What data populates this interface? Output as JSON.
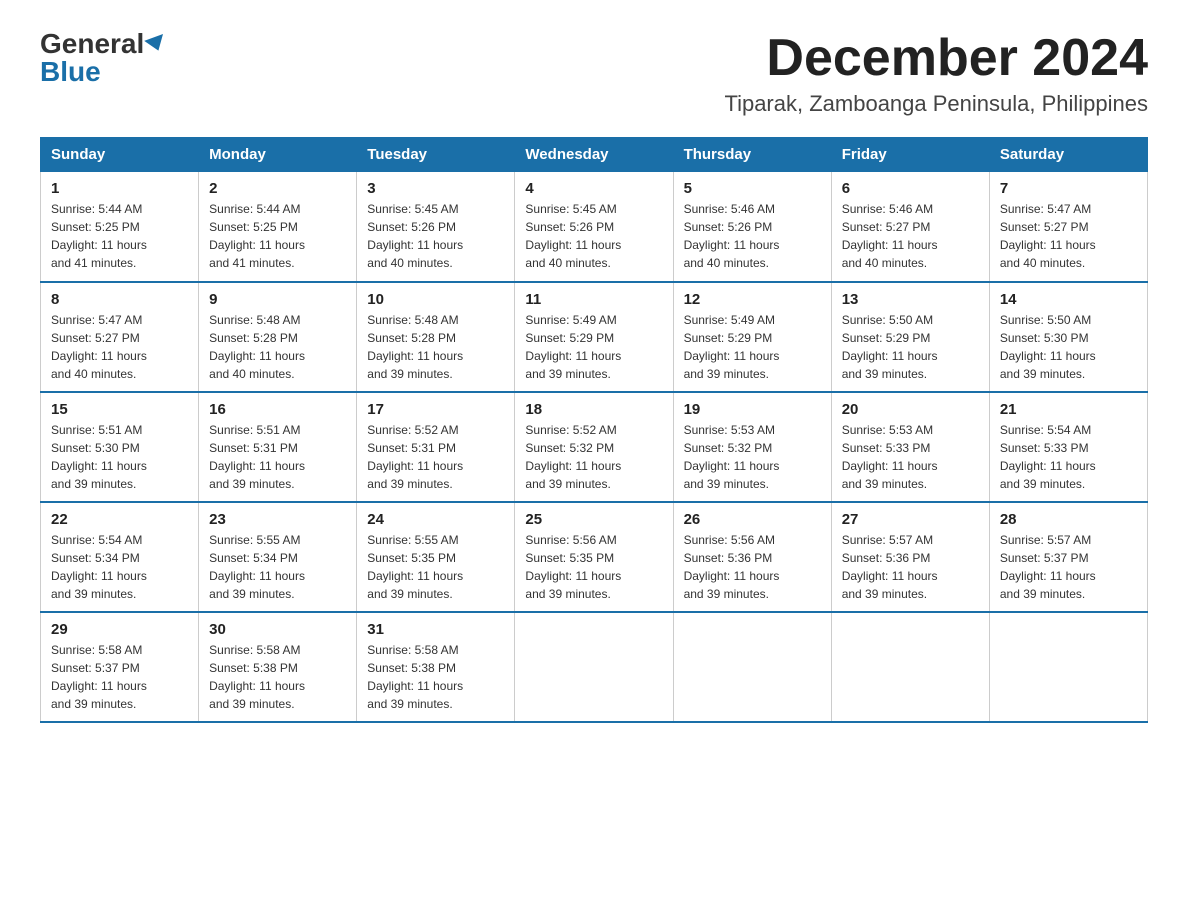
{
  "logo": {
    "general": "General",
    "blue": "Blue"
  },
  "title": "December 2024",
  "subtitle": "Tiparak, Zamboanga Peninsula, Philippines",
  "days_header": [
    "Sunday",
    "Monday",
    "Tuesday",
    "Wednesday",
    "Thursday",
    "Friday",
    "Saturday"
  ],
  "weeks": [
    [
      {
        "day": "1",
        "info": "Sunrise: 5:44 AM\nSunset: 5:25 PM\nDaylight: 11 hours\nand 41 minutes."
      },
      {
        "day": "2",
        "info": "Sunrise: 5:44 AM\nSunset: 5:25 PM\nDaylight: 11 hours\nand 41 minutes."
      },
      {
        "day": "3",
        "info": "Sunrise: 5:45 AM\nSunset: 5:26 PM\nDaylight: 11 hours\nand 40 minutes."
      },
      {
        "day": "4",
        "info": "Sunrise: 5:45 AM\nSunset: 5:26 PM\nDaylight: 11 hours\nand 40 minutes."
      },
      {
        "day": "5",
        "info": "Sunrise: 5:46 AM\nSunset: 5:26 PM\nDaylight: 11 hours\nand 40 minutes."
      },
      {
        "day": "6",
        "info": "Sunrise: 5:46 AM\nSunset: 5:27 PM\nDaylight: 11 hours\nand 40 minutes."
      },
      {
        "day": "7",
        "info": "Sunrise: 5:47 AM\nSunset: 5:27 PM\nDaylight: 11 hours\nand 40 minutes."
      }
    ],
    [
      {
        "day": "8",
        "info": "Sunrise: 5:47 AM\nSunset: 5:27 PM\nDaylight: 11 hours\nand 40 minutes."
      },
      {
        "day": "9",
        "info": "Sunrise: 5:48 AM\nSunset: 5:28 PM\nDaylight: 11 hours\nand 40 minutes."
      },
      {
        "day": "10",
        "info": "Sunrise: 5:48 AM\nSunset: 5:28 PM\nDaylight: 11 hours\nand 39 minutes."
      },
      {
        "day": "11",
        "info": "Sunrise: 5:49 AM\nSunset: 5:29 PM\nDaylight: 11 hours\nand 39 minutes."
      },
      {
        "day": "12",
        "info": "Sunrise: 5:49 AM\nSunset: 5:29 PM\nDaylight: 11 hours\nand 39 minutes."
      },
      {
        "day": "13",
        "info": "Sunrise: 5:50 AM\nSunset: 5:29 PM\nDaylight: 11 hours\nand 39 minutes."
      },
      {
        "day": "14",
        "info": "Sunrise: 5:50 AM\nSunset: 5:30 PM\nDaylight: 11 hours\nand 39 minutes."
      }
    ],
    [
      {
        "day": "15",
        "info": "Sunrise: 5:51 AM\nSunset: 5:30 PM\nDaylight: 11 hours\nand 39 minutes."
      },
      {
        "day": "16",
        "info": "Sunrise: 5:51 AM\nSunset: 5:31 PM\nDaylight: 11 hours\nand 39 minutes."
      },
      {
        "day": "17",
        "info": "Sunrise: 5:52 AM\nSunset: 5:31 PM\nDaylight: 11 hours\nand 39 minutes."
      },
      {
        "day": "18",
        "info": "Sunrise: 5:52 AM\nSunset: 5:32 PM\nDaylight: 11 hours\nand 39 minutes."
      },
      {
        "day": "19",
        "info": "Sunrise: 5:53 AM\nSunset: 5:32 PM\nDaylight: 11 hours\nand 39 minutes."
      },
      {
        "day": "20",
        "info": "Sunrise: 5:53 AM\nSunset: 5:33 PM\nDaylight: 11 hours\nand 39 minutes."
      },
      {
        "day": "21",
        "info": "Sunrise: 5:54 AM\nSunset: 5:33 PM\nDaylight: 11 hours\nand 39 minutes."
      }
    ],
    [
      {
        "day": "22",
        "info": "Sunrise: 5:54 AM\nSunset: 5:34 PM\nDaylight: 11 hours\nand 39 minutes."
      },
      {
        "day": "23",
        "info": "Sunrise: 5:55 AM\nSunset: 5:34 PM\nDaylight: 11 hours\nand 39 minutes."
      },
      {
        "day": "24",
        "info": "Sunrise: 5:55 AM\nSunset: 5:35 PM\nDaylight: 11 hours\nand 39 minutes."
      },
      {
        "day": "25",
        "info": "Sunrise: 5:56 AM\nSunset: 5:35 PM\nDaylight: 11 hours\nand 39 minutes."
      },
      {
        "day": "26",
        "info": "Sunrise: 5:56 AM\nSunset: 5:36 PM\nDaylight: 11 hours\nand 39 minutes."
      },
      {
        "day": "27",
        "info": "Sunrise: 5:57 AM\nSunset: 5:36 PM\nDaylight: 11 hours\nand 39 minutes."
      },
      {
        "day": "28",
        "info": "Sunrise: 5:57 AM\nSunset: 5:37 PM\nDaylight: 11 hours\nand 39 minutes."
      }
    ],
    [
      {
        "day": "29",
        "info": "Sunrise: 5:58 AM\nSunset: 5:37 PM\nDaylight: 11 hours\nand 39 minutes."
      },
      {
        "day": "30",
        "info": "Sunrise: 5:58 AM\nSunset: 5:38 PM\nDaylight: 11 hours\nand 39 minutes."
      },
      {
        "day": "31",
        "info": "Sunrise: 5:58 AM\nSunset: 5:38 PM\nDaylight: 11 hours\nand 39 minutes."
      },
      null,
      null,
      null,
      null
    ]
  ]
}
